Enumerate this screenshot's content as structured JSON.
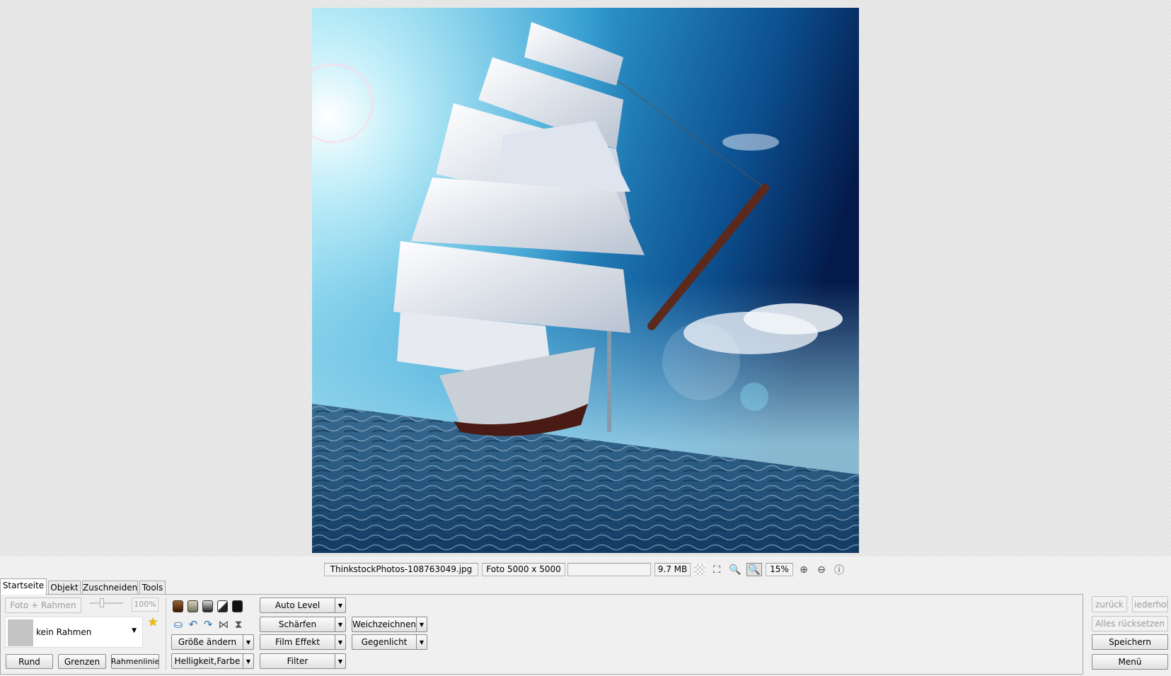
{
  "photo": {
    "description_icon": "ship-photo"
  },
  "status": {
    "filename": "ThinkstockPhotos-108763049.jpg",
    "dimensions": "Foto 5000 x 5000",
    "empty": "",
    "filesize": "9.7 MB",
    "zoom": "15%"
  },
  "tabs": [
    "Startseite",
    "Objekt",
    "Zuschneiden",
    "Tools"
  ],
  "frame": {
    "foto_rahmen": "Foto + Rahmen",
    "percent": "100%",
    "selected": "kein Rahmen",
    "rund": "Rund",
    "grenzen": "Grenzen",
    "rahmenlinie": "Rahmenlinie"
  },
  "swatch_colors": [
    "#6b3a12",
    "#a8a48a",
    "#555555",
    "#888888",
    "#111111"
  ],
  "effects": {
    "auto_level": "Auto Level",
    "schaerfen": "Schärfen",
    "weichzeichnen": "Weichzeichnen",
    "groesse": "Größe ändern",
    "film": "Film Effekt",
    "gegenlicht": "Gegenlicht",
    "helligkeit": "Helligkeit,Farbe",
    "filter": "Filter"
  },
  "actions": {
    "zurueck": "zurück",
    "wiederholen": "iederholen",
    "reset": "Alles rücksetzen",
    "save": "Speichern",
    "menu": "Menü"
  }
}
